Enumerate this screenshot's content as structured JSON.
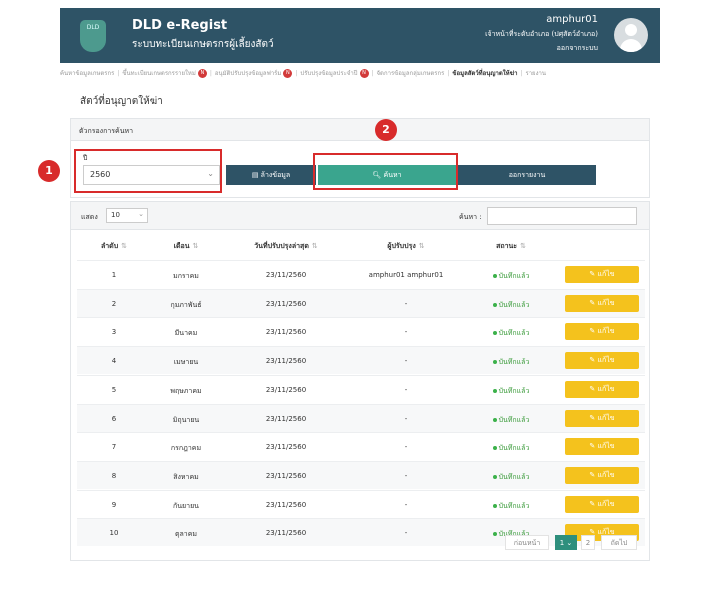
{
  "header": {
    "logo_text": "DLD",
    "title": "DLD e-Regist",
    "subtitle": "ระบบทะเบียนเกษตรกรผู้เลี้ยงสัตว์",
    "user_name": "amphur01",
    "user_role": "เจ้าหน้าที่ระดับอำเภอ (ปศุสัตว์อำเภอ)",
    "logout": "ออกจากระบบ"
  },
  "nav": {
    "items": [
      {
        "label": "ค้นหาข้อมูลเกษตรกร",
        "badge": ""
      },
      {
        "label": "ขึ้นทะเบียนเกษตรกรรายใหม่",
        "badge": "N"
      },
      {
        "label": "อนุมัติปรับปรุงข้อมูลฟาร์ม",
        "badge": "N"
      },
      {
        "label": "ปรับปรุงข้อมูลประจำปี",
        "badge": "N"
      },
      {
        "label": "จัดการข้อมูลกลุ่มเกษตรกร",
        "badge": ""
      },
      {
        "label": "ข้อมูลสัตว์ที่อนุญาตให้ฆ่า",
        "badge": "",
        "active": true
      },
      {
        "label": "รายงาน",
        "badge": ""
      }
    ]
  },
  "page": {
    "title": "สัตว์ที่อนุญาตให้ฆ่า"
  },
  "filter": {
    "heading": "ตัวกรองการค้นหา",
    "year_label": "ปี",
    "year_value": "2560",
    "clear_label": "ล้างข้อมูล",
    "search_label": "ค้นหา",
    "export_label": "ออกรายงาน"
  },
  "annotations": {
    "marker_1": "1",
    "marker_2": "2"
  },
  "table": {
    "show_label": "แสดง",
    "page_size": "10",
    "search_label": "ค้นหา :",
    "columns": [
      "ลำดับ",
      "เดือน",
      "วันที่ปรับปรุงล่าสุด",
      "ผู้ปรับปรุง",
      "สถานะ"
    ],
    "rows": [
      {
        "no": "1",
        "month": "มกราคม",
        "date": "23/11/2560",
        "editor": "amphur01 amphur01",
        "status": "บันทึกแล้ว",
        "action": "แก้ไข"
      },
      {
        "no": "2",
        "month": "กุมภาพันธ์",
        "date": "23/11/2560",
        "editor": "-",
        "status": "บันทึกแล้ว",
        "action": "แก้ไข"
      },
      {
        "no": "3",
        "month": "มีนาคม",
        "date": "23/11/2560",
        "editor": "-",
        "status": "บันทึกแล้ว",
        "action": "แก้ไข"
      },
      {
        "no": "4",
        "month": "เมษายน",
        "date": "23/11/2560",
        "editor": "-",
        "status": "บันทึกแล้ว",
        "action": "แก้ไข"
      },
      {
        "no": "5",
        "month": "พฤษภาคม",
        "date": "23/11/2560",
        "editor": "-",
        "status": "บันทึกแล้ว",
        "action": "แก้ไข"
      },
      {
        "no": "6",
        "month": "มิถุนายน",
        "date": "23/11/2560",
        "editor": "-",
        "status": "บันทึกแล้ว",
        "action": "แก้ไข"
      },
      {
        "no": "7",
        "month": "กรกฎาคม",
        "date": "23/11/2560",
        "editor": "-",
        "status": "บันทึกแล้ว",
        "action": "แก้ไข"
      },
      {
        "no": "8",
        "month": "สิงหาคม",
        "date": "23/11/2560",
        "editor": "-",
        "status": "บันทึกแล้ว",
        "action": "แก้ไข"
      },
      {
        "no": "9",
        "month": "กันยายน",
        "date": "23/11/2560",
        "editor": "-",
        "status": "บันทึกแล้ว",
        "action": "แก้ไข"
      },
      {
        "no": "10",
        "month": "ตุลาคม",
        "date": "23/11/2560",
        "editor": "-",
        "status": "บันทึกแล้ว",
        "action": "แก้ไข"
      }
    ]
  },
  "pagination": {
    "prev": "ก่อนหน้า",
    "current": "1",
    "page2": "2",
    "next": "ถัดไป"
  }
}
